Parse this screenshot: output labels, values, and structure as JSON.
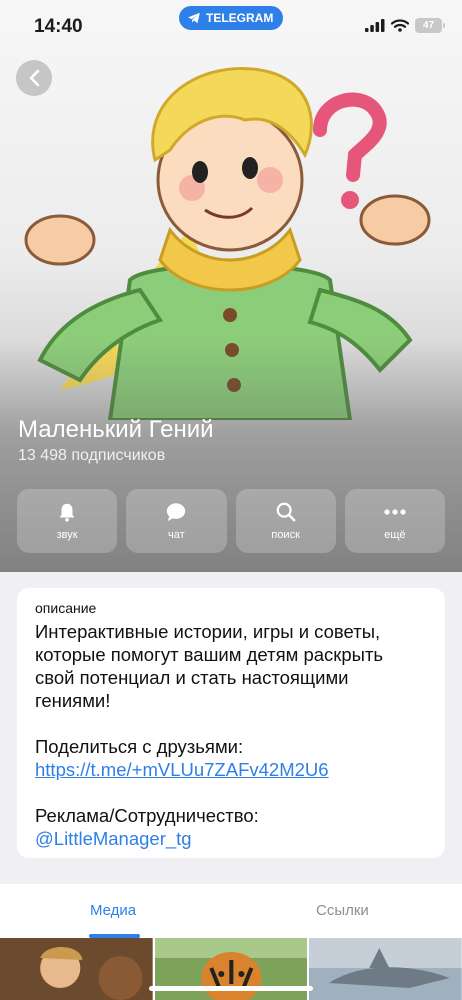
{
  "status_bar": {
    "time": "14:40",
    "app_pill": "TELEGRAM",
    "battery": "47"
  },
  "channel": {
    "title": "Маленький Гений",
    "subscribers": "13 498 подписчиков"
  },
  "actions": [
    {
      "label": "звук",
      "icon": "bell-icon"
    },
    {
      "label": "чат",
      "icon": "chat-bubble-icon"
    },
    {
      "label": "поиск",
      "icon": "search-icon"
    },
    {
      "label": "ещё",
      "icon": "more-icon"
    }
  ],
  "info": {
    "caption": "описание",
    "description": "Интерактивные истории, игры и советы, которые помогут вашим детям раскрыть свой потенциал и стать настоящими гениями!",
    "share_label": "Поделиться с друзьями:",
    "share_link": "https://t.me/+mVLUu7ZAFv42M2U6",
    "ads_label": "Реклама/Сотрудничество:",
    "ads_contact": "@LittleManager_tg"
  },
  "tabs": {
    "media": "Медиа",
    "links": "Ссылки"
  },
  "colors": {
    "accent": "#2f7fe8"
  }
}
